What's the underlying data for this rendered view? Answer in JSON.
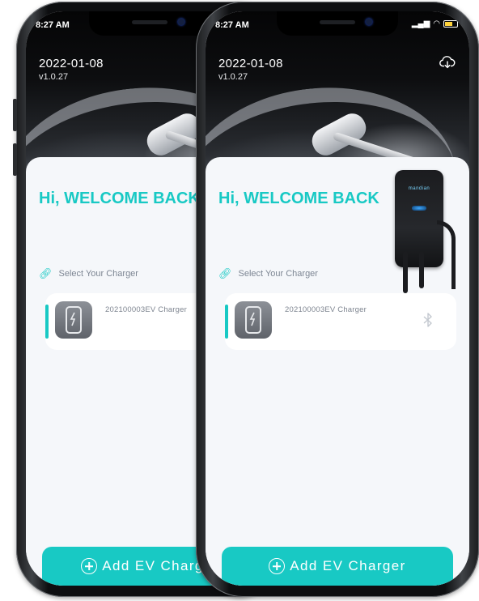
{
  "phones": [
    {
      "status_time": "8:27 AM",
      "date": "2022-01-08",
      "version": "v1.0.27",
      "welcome": "Hi, WELCOME BACK",
      "select_label": "Select Your Charger",
      "charger_name": "202100003EV Charger",
      "add_button": "Add EV Charger"
    },
    {
      "status_time": "8:27 AM",
      "date": "2022-01-08",
      "version": "v1.0.27",
      "welcome": "Hi, WELCOME BACK",
      "select_label": "Select Your Charger",
      "charger_name": "202100003EV Charger",
      "add_button": "Add EV Charger"
    }
  ],
  "wallbox": {
    "brand": "mandian"
  },
  "icons": {
    "cloud": "cloud-download-icon",
    "link": "link-icon",
    "bluetooth": "bluetooth-icon",
    "plus": "plus-circle-icon"
  },
  "colors": {
    "accent": "#18c9c4",
    "card_bg": "#f5f7fa"
  }
}
